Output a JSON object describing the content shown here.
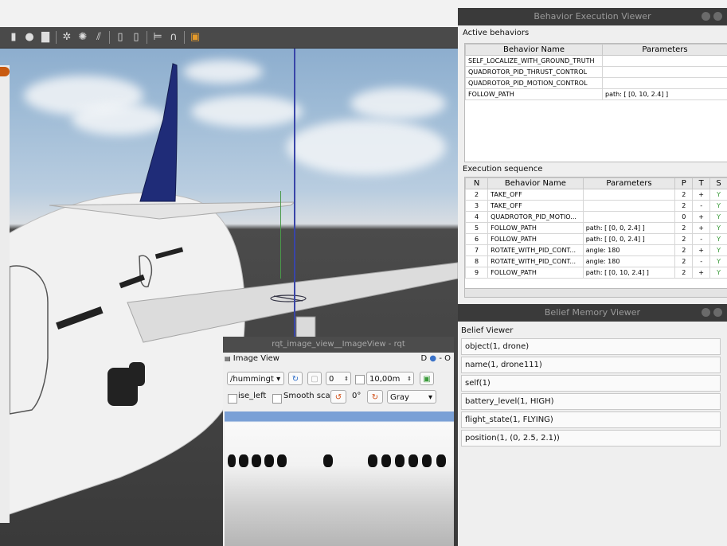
{
  "behavior_viewer": {
    "title": "Behavior Execution Viewer",
    "active_label": "Active behaviors",
    "active_headers": [
      "Behavior Name",
      "Parameters"
    ],
    "active_rows": [
      [
        "SELF_LOCALIZE_WITH_GROUND_TRUTH",
        ""
      ],
      [
        "QUADROTOR_PID_THRUST_CONTROL",
        ""
      ],
      [
        "QUADROTOR_PID_MOTION_CONTROL",
        ""
      ],
      [
        "FOLLOW_PATH",
        "path: [ [0, 10, 2.4] ]"
      ]
    ],
    "exec_label": "Execution sequence",
    "exec_headers": [
      "N",
      "Behavior Name",
      "Parameters",
      "P",
      "T",
      "S"
    ],
    "exec_rows": [
      [
        "2",
        "TAKE_OFF",
        "",
        "2",
        "+",
        "Y"
      ],
      [
        "3",
        "TAKE_OFF",
        "",
        "2",
        "-",
        "Y"
      ],
      [
        "4",
        "QUADROTOR_PID_MOTIO...",
        "",
        "0",
        "+",
        "Y"
      ],
      [
        "5",
        "FOLLOW_PATH",
        "path: [ [0, 0, 2.4] ]",
        "2",
        "+",
        "Y"
      ],
      [
        "6",
        "FOLLOW_PATH",
        "path: [ [0, 0, 2.4] ]",
        "2",
        "-",
        "Y"
      ],
      [
        "7",
        "ROTATE_WITH_PID_CONT...",
        "angle: 180",
        "2",
        "+",
        "Y"
      ],
      [
        "8",
        "ROTATE_WITH_PID_CONT...",
        "angle: 180",
        "2",
        "-",
        "Y"
      ],
      [
        "9",
        "FOLLOW_PATH",
        "path: [ [0, 10, 2.4] ]",
        "2",
        "+",
        "Y"
      ]
    ]
  },
  "belief_viewer": {
    "title": "Belief Memory Viewer",
    "label": "Belief Viewer",
    "beliefs": [
      "object(1, drone)",
      "name(1, drone111)",
      "self(1)",
      "battery_level(1, HIGH)",
      "flight_state(1, FLYING)",
      "position(1, (0, 2.5, 2.1))"
    ]
  },
  "image_view": {
    "window_title": "rqt_image_view__ImageView - rqt",
    "panel_title": "Image View",
    "panel_controls": "D",
    "panel_controls_right": "- O",
    "topic": "/hummingt",
    "rotation_value": "0",
    "distance_value": "10,00m",
    "checkbox_label_1": "ise_left",
    "checkbox_label_2": "Smooth sca",
    "angle_label": "0°",
    "color_scheme": "Gray"
  },
  "colors": {
    "panel_bg": "#efefef",
    "title_bar": "#3a3a3a",
    "status_green": "#3a9a3a"
  }
}
